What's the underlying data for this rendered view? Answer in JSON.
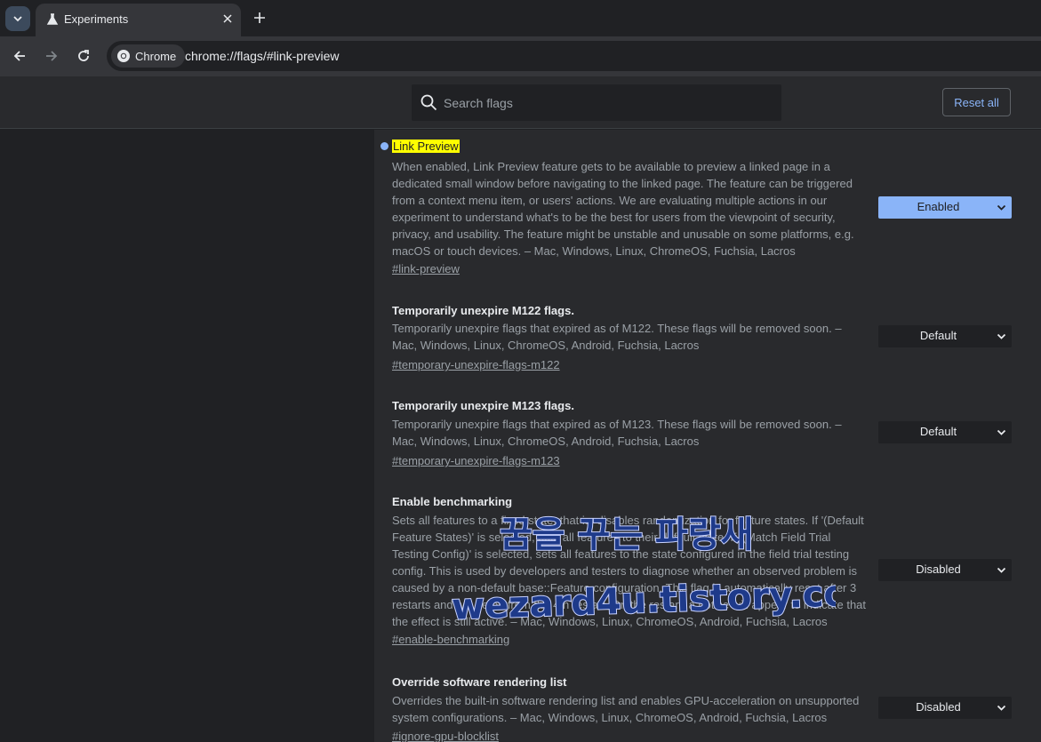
{
  "browser": {
    "tab_title": "Experiments",
    "chip_label": "Chrome",
    "url_scheme": "chrome://",
    "url_rest": "flags/#link-preview"
  },
  "header": {
    "search_placeholder": "Search flags",
    "reset_label": "Reset all"
  },
  "flags": [
    {
      "title": "Link Preview",
      "description": "When enabled, Link Preview feature gets to be available to preview a linked page in a dedicated small window before navigating to the linked page. The feature can be triggered from a context menu item, or users' actions. We are evaluating multiple actions in our experiment to understand what's to be the best for users from the viewpoint of security, privacy, and usability. The feature might be unstable and unusable on some platforms, e.g. macOS or touch devices. – Mac, Windows, Linux, ChromeOS, Fuchsia, Lacros",
      "link": "#link-preview",
      "value": "Enabled"
    },
    {
      "title": "Temporarily unexpire M122 flags.",
      "description": "Temporarily unexpire flags that expired as of M122. These flags will be removed soon. – Mac, Windows, Linux, ChromeOS, Android, Fuchsia, Lacros",
      "link": "#temporary-unexpire-flags-m122",
      "value": "Default"
    },
    {
      "title": "Temporarily unexpire M123 flags.",
      "description": "Temporarily unexpire flags that expired as of M123. These flags will be removed soon. – Mac, Windows, Linux, ChromeOS, Android, Fuchsia, Lacros",
      "link": "#temporary-unexpire-flags-m123",
      "value": "Default"
    },
    {
      "title": "Enable benchmarking",
      "description": "Sets all features to a fixed state; that is, disables randomization for feature states. If '(Default Feature States)' is selected, sets all features to their default state. If '(Match Field Trial Testing Config)' is selected, sets all features to the state configured in the field trial testing config. This is used by developers and testers to diagnose whether an observed problem is caused by a non-default base::Feature configuration. This flag is automatically reset after 3 restarts and will be off from the 4th restart. On the restart, a notice will appear to indicate that the effect is still active. – Mac, Windows, Linux, ChromeOS, Android, Fuchsia, Lacros",
      "link": "#enable-benchmarking",
      "value": "Disabled"
    },
    {
      "title": "Override software rendering list",
      "description": "Overrides the built-in software rendering list and enables GPU-acceleration on unsupported system configurations. – Mac, Windows, Linux, ChromeOS, Android, Fuchsia, Lacros",
      "link": "#ignore-gpu-blocklist",
      "value": "Disabled"
    }
  ],
  "watermark": {
    "line1": "꿈을 꾸는 파랑새",
    "line2": "wezard4u.tistory.com"
  },
  "colors": {
    "accent": "#8ab4f8",
    "highlight": "#ffff00",
    "background": "#202124",
    "panel": "#292a2d"
  }
}
